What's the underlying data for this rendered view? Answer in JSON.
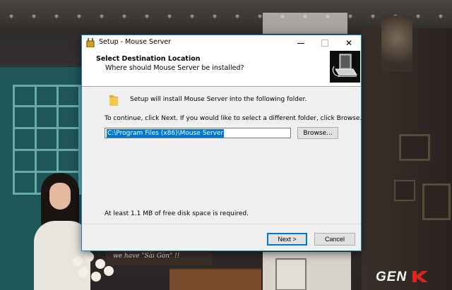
{
  "window": {
    "title": "Setup - Mouse Server",
    "minimize_icon": "minimize-icon",
    "maximize_icon": "maximize-icon",
    "close_glyph": "✕"
  },
  "header": {
    "title": "Select Destination Location",
    "subtitle": "Where should Mouse Server be installed?",
    "logo_icon": "setup-computer-icon"
  },
  "body": {
    "folder_icon": "folder-icon",
    "install_message": "Setup will install Mouse Server into the following folder.",
    "continue_message": "To continue, click Next. If you would like to select a different folder, click Browse.",
    "path_value": "C:\\Program Files (x86)\\Mouse Server",
    "browse_label": "Browse...",
    "space_message": "At least 1.1 MB of free disk space is required."
  },
  "footer": {
    "next_label": "Next >",
    "cancel_label": "Cancel"
  },
  "background": {
    "chalk_text": "we have \"Sài Gòn\" !!"
  },
  "watermark": {
    "text": "GENK"
  },
  "colors": {
    "accent": "#0078d7",
    "dialog_bg": "#f0f0f0",
    "button_bg": "#e1e1e1",
    "watermark_red": "#e02424"
  }
}
